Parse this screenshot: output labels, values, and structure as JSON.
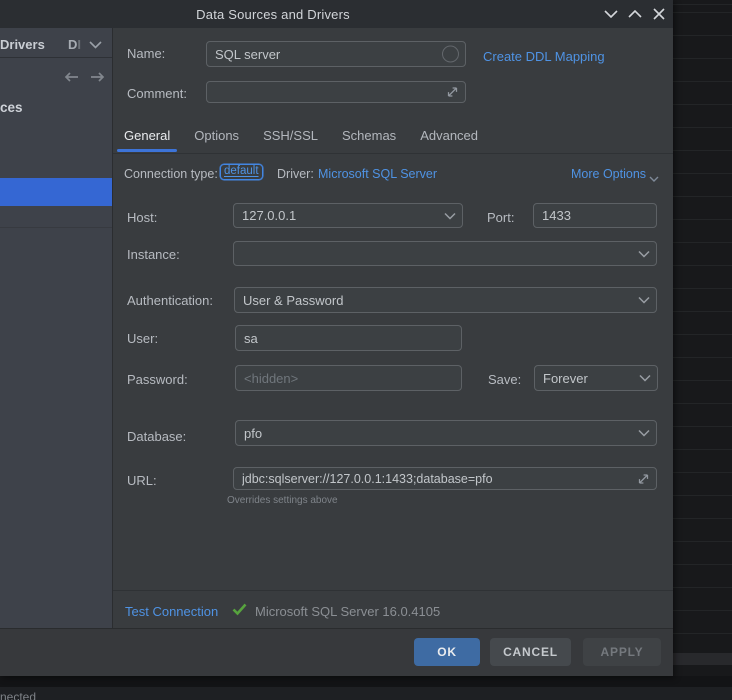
{
  "titlebar": {
    "title": "Data Sources and Drivers"
  },
  "left_panel": {
    "header_title": "Drivers",
    "header_selector": "D",
    "header_selector_faded": "I",
    "section_label": "ces"
  },
  "form": {
    "name": {
      "label": "Name:",
      "value": "SQL server"
    },
    "create_ddl_link": "Create DDL Mapping",
    "comment": {
      "label": "Comment:",
      "value": ""
    },
    "tabs": {
      "general": "General",
      "options": "Options",
      "ssh_ssl": "SSH/SSL",
      "schemas": "Schemas",
      "advanced": "Advanced"
    },
    "connection_type": {
      "label": "Connection type:",
      "value": "default"
    },
    "driver": {
      "label": "Driver:",
      "value": "Microsoft SQL Server"
    },
    "more_options": "More Options",
    "host": {
      "label": "Host:",
      "value": "127.0.0.1"
    },
    "port": {
      "label": "Port:",
      "value": "1433"
    },
    "instance": {
      "label": "Instance:",
      "value": ""
    },
    "authentication": {
      "label": "Authentication:",
      "value": "User & Password"
    },
    "user": {
      "label": "User:",
      "value": "sa"
    },
    "password": {
      "label": "Password:",
      "placeholder": "<hidden>"
    },
    "save": {
      "label": "Save:",
      "value": "Forever"
    },
    "database": {
      "label": "Database:",
      "value": "pfo"
    },
    "url": {
      "label": "URL:",
      "value": "jdbc:sqlserver://127.0.0.1:1433;database=pfo",
      "hint": "Overrides settings above"
    }
  },
  "footer": {
    "test_connection": "Test Connection",
    "test_result": "Microsoft SQL Server 16.0.4105",
    "ok": "OK",
    "cancel": "CANCEL",
    "apply": "APPLY"
  },
  "statusbar": {
    "text": "nected"
  },
  "colors": {
    "accent": "#3d74d8",
    "link": "#4f93e4",
    "selection_blue": "#3567d3",
    "ok_button": "#3e6ba3",
    "success_green": "#57a33e",
    "dialog_bg": "#393c3f",
    "left_panel_bg": "#3e424a",
    "titlebar_bg": "#2b2e32"
  }
}
